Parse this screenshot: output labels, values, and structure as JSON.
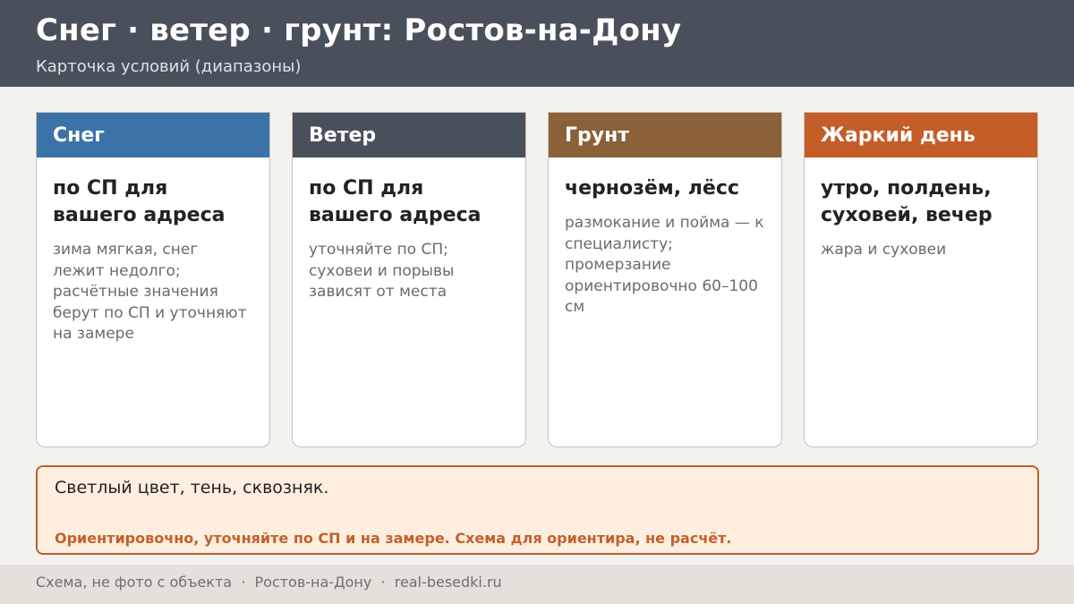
{
  "header": {
    "title": "Снег · ветер · грунт: Ростов-на-Дону",
    "subtitle": "Карточка условий (диапазоны)"
  },
  "cards": [
    {
      "title": "Снег",
      "value": "по СП для вашего адреса",
      "note": "зима мягкая, снег лежит недолго; расчётные значения берут по СП и уточняют на замере",
      "color": "#3b73a9"
    },
    {
      "title": "Ветер",
      "value": "по СП для вашего адреса",
      "note": "уточняйте по СП; суховеи и порывы зависят от места",
      "color": "#48505b"
    },
    {
      "title": "Грунт",
      "value": "чернозём, лёсс",
      "note": "размокание и пойма — к специалисту; промерзание ориентировочно 60–100 см",
      "color": "#8a6138"
    },
    {
      "title": "Жаркий день",
      "value": "утро, полдень, суховей, вечер",
      "note": "жара и суховеи",
      "color": "#c45d27"
    }
  ],
  "notice": {
    "text": "Светлый цвет, тень, сквозняк.",
    "warning": "Ориентировочно, уточняйте по СП и на замере. Схема для ориентира, не расчёт."
  },
  "footer": {
    "text": "Схема, не фото с объекта  ·  Ростов-на-Дону  ·  real-besedki.ru"
  }
}
